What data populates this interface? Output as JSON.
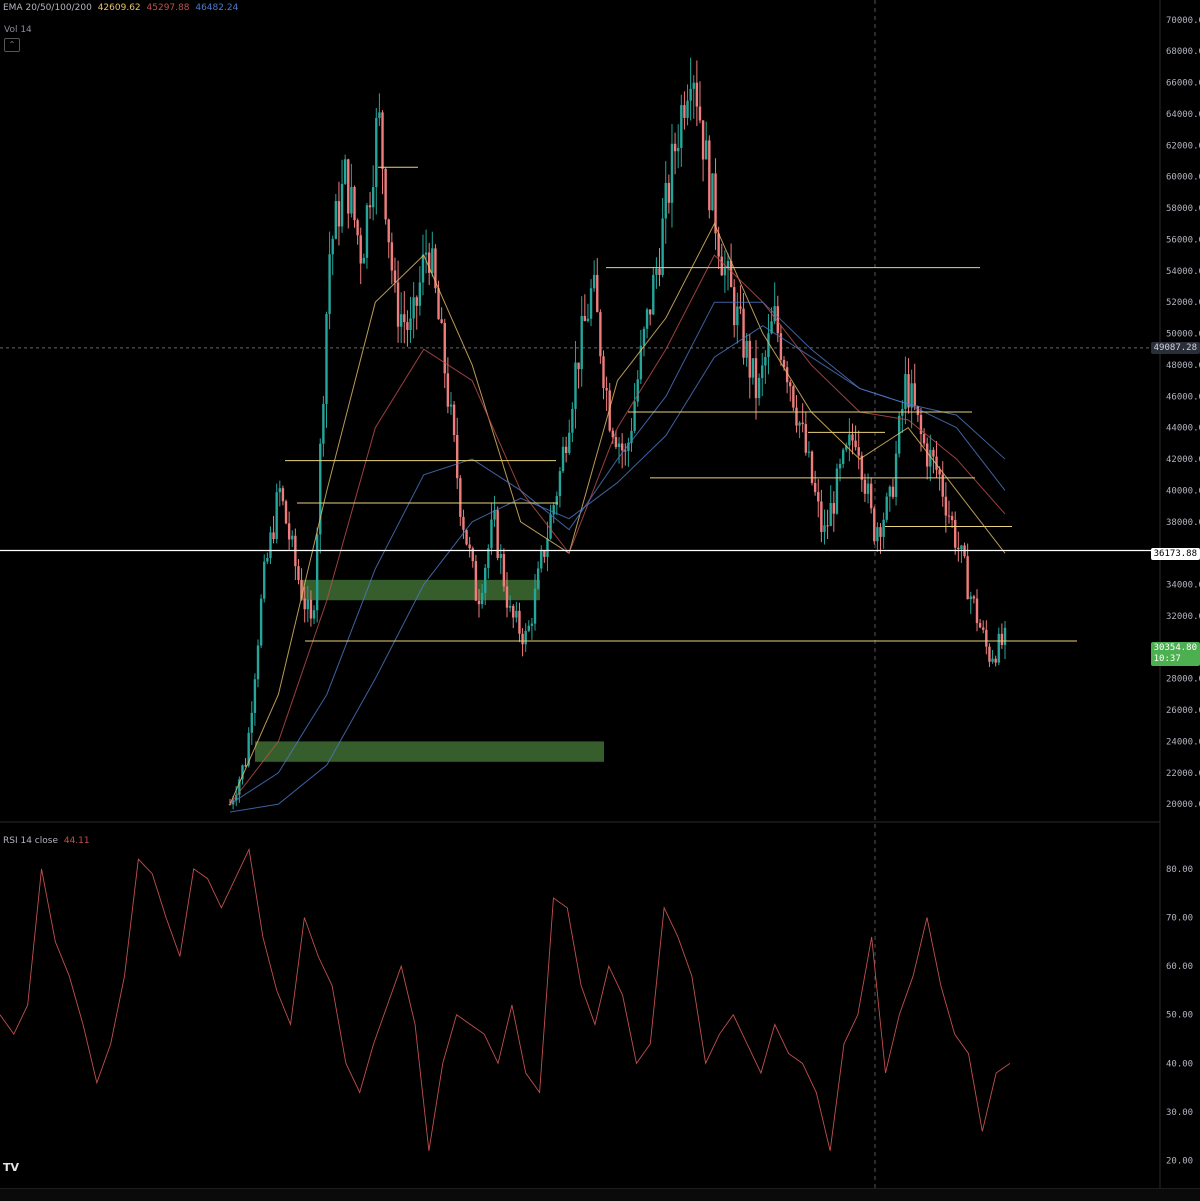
{
  "legend": {
    "ema_label": "EMA 20/50/100/200",
    "ema_values": [
      "42609.62",
      "45297.88",
      "46482.24"
    ],
    "ema_colors": [
      "#e8c16a",
      "#c0504d",
      "#4e79c7"
    ],
    "vol_label": "Vol 14",
    "rsi_label": "RSI 14 close",
    "rsi_value": "44.11"
  },
  "price_axis": {
    "ticks": [
      "70000.00",
      "68000.00",
      "66000.00",
      "64000.00",
      "62000.00",
      "60000.00",
      "58000.00",
      "56000.00",
      "54000.00",
      "52000.00",
      "50000.00",
      "48000.00",
      "46000.00",
      "44000.00",
      "42000.00",
      "40000.00",
      "38000.00",
      "36000.00",
      "34000.00",
      "32000.00",
      "28000.00",
      "26000.00",
      "24000.00",
      "22000.00",
      "20000.00"
    ],
    "crosshair_price": "49087.28",
    "level_price": "36173.88",
    "last_price": "30354.80",
    "countdown": "10:37"
  },
  "rsi_axis": {
    "ticks": [
      "80.00",
      "70.00",
      "60.00",
      "50.00",
      "40.00",
      "30.00",
      "20.00"
    ]
  },
  "colors": {
    "up": "#26a69a",
    "down": "#ef7d7d",
    "level_line": "#e8d27a",
    "white_line": "#ffffff",
    "zone": "#3f6f35",
    "rsi": "#c0504d",
    "last_price_bg": "#4caf50"
  },
  "chart_data": [
    {
      "type": "line",
      "title": "",
      "ylim": [
        19500,
        70500
      ],
      "ema_series": [
        {
          "name": "EMA 20",
          "values": [
            20000,
            27000,
            40000,
            52000,
            55000,
            48000,
            38000,
            36000,
            47000,
            51000,
            57000,
            50000,
            45000,
            42000,
            44000,
            40000,
            36000
          ]
        },
        {
          "name": "EMA 50",
          "values": [
            20000,
            24000,
            33000,
            44000,
            49000,
            47000,
            40000,
            36000,
            44000,
            49000,
            55000,
            52000,
            48000,
            45000,
            44500,
            42000,
            38500
          ]
        },
        {
          "name": "EMA 100",
          "values": [
            20000,
            22000,
            27000,
            35000,
            41000,
            42000,
            40000,
            37500,
            42000,
            46000,
            52000,
            52000,
            49000,
            46500,
            45500,
            44000,
            40000
          ]
        },
        {
          "name": "EMA 200",
          "values": [
            19500,
            20000,
            22500,
            28000,
            34000,
            38000,
            39500,
            38200,
            40500,
            43500,
            48500,
            50500,
            48500,
            46500,
            45500,
            44800,
            42000
          ]
        }
      ],
      "price_path": [
        20000,
        23000,
        34000,
        40000,
        35000,
        31000,
        55000,
        60000,
        55000,
        64000,
        52000,
        50000,
        56000,
        48000,
        39000,
        33000,
        38000,
        32000,
        30500,
        36000,
        41000,
        48000,
        53000,
        45000,
        42000,
        49000,
        55000,
        62000,
        68000,
        60000,
        54000,
        50000,
        46000,
        51000,
        47000,
        42000,
        37000,
        41000,
        44000,
        37500,
        39000,
        47000,
        43000,
        41000,
        37000,
        33000,
        29500,
        30354
      ],
      "horizontal_levels": [
        60600,
        54200,
        45000,
        43700,
        41900,
        40800,
        39200,
        37700,
        36173,
        30400
      ],
      "zones": [
        [
          33000,
          34300
        ],
        [
          22700,
          24000
        ]
      ]
    },
    {
      "type": "line",
      "title": "",
      "ylim": [
        16,
        88
      ],
      "series": [
        {
          "name": "",
          "values": [
            50,
            46,
            52,
            80,
            65,
            58,
            48,
            36,
            44,
            58,
            82,
            79,
            70,
            62,
            80,
            78,
            72,
            78,
            84,
            66,
            55,
            48,
            70,
            62,
            56,
            40,
            34,
            44,
            52,
            60,
            48,
            22,
            40,
            50,
            48,
            46,
            40,
            52,
            38,
            34,
            74,
            72,
            56,
            48,
            60,
            54,
            40,
            44,
            72,
            66,
            58,
            40,
            46,
            50,
            44,
            38,
            48,
            42,
            40,
            34,
            22,
            44,
            50,
            66,
            38,
            50,
            58,
            70,
            56,
            46,
            42,
            26,
            38,
            40
          ]
        }
      ]
    }
  ]
}
